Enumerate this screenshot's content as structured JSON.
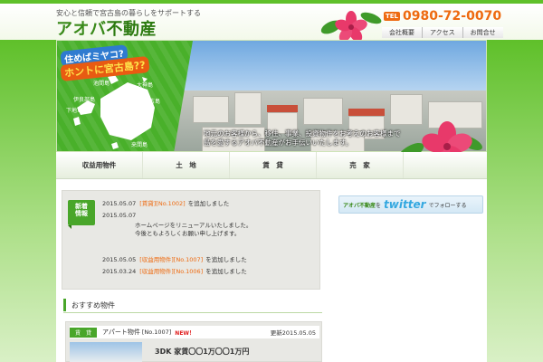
{
  "header": {
    "tagline": "安心と信頼で宮古島の暮らしをサポートする",
    "logo_kana": "アオバ",
    "logo_kanji": "不動産",
    "tel_label": "TEL",
    "tel_number": "0980-72-0070"
  },
  "topnav": {
    "items": [
      {
        "label": "会社概要"
      },
      {
        "label": "アクセス"
      },
      {
        "label": "お問合せ"
      }
    ]
  },
  "hero": {
    "catch_line1": "住めばミヤコ?",
    "catch_line2": "ホントに宮古島??",
    "map_labels": [
      "池間島",
      "大神島",
      "伊良部島",
      "宮古島",
      "下地島",
      "宮古島市",
      "来間島"
    ],
    "text_lines": [
      "地元のお客様から、移住、事業、投資物件をお考えのお客様まで",
      "島を愛するアオバ不動産がお手伝いいたします。"
    ]
  },
  "mainnav": {
    "items": [
      {
        "label": "収益用物件"
      },
      {
        "label": "土　地"
      },
      {
        "label": "賃　貸"
      },
      {
        "label": "売　家"
      }
    ]
  },
  "news": {
    "tag_line1": "新着",
    "tag_line2": "情報",
    "items": [
      {
        "date": "2015.05.07",
        "tag": "[賃貸][No.1002]",
        "text": "を追加しました"
      },
      {
        "date": "2015.05.07",
        "tag": "",
        "text": ""
      },
      {
        "date": "2015.05.05",
        "tag": "[収益用物件][No.1007]",
        "text": "を追加しました"
      },
      {
        "date": "2015.03.24",
        "tag": "[収益用物件][No.1006]",
        "text": "を追加しました"
      }
    ],
    "body_lines": [
      "ホームページをリニューアルいたしました。",
      "今後ともよろしくお願い申し上げます。"
    ]
  },
  "recommended": {
    "heading": "おすすめ物件",
    "card": {
      "badge": "賃　貸",
      "name": "アパート物件",
      "number": "[No.1007]",
      "new_label": "NEW！",
      "date": "更新2015.05.05",
      "spec": "3DK 家賃〇〇1万〇〇1万円"
    }
  },
  "twitter": {
    "prefix_brand": "アオバ不動産",
    "prefix_connector": "を",
    "logo": "twitter",
    "suffix": "でフォローする"
  },
  "colors": {
    "brand_green": "#49a62a",
    "accent_orange": "#ee6a10",
    "twitter_blue": "#34a8e0"
  }
}
